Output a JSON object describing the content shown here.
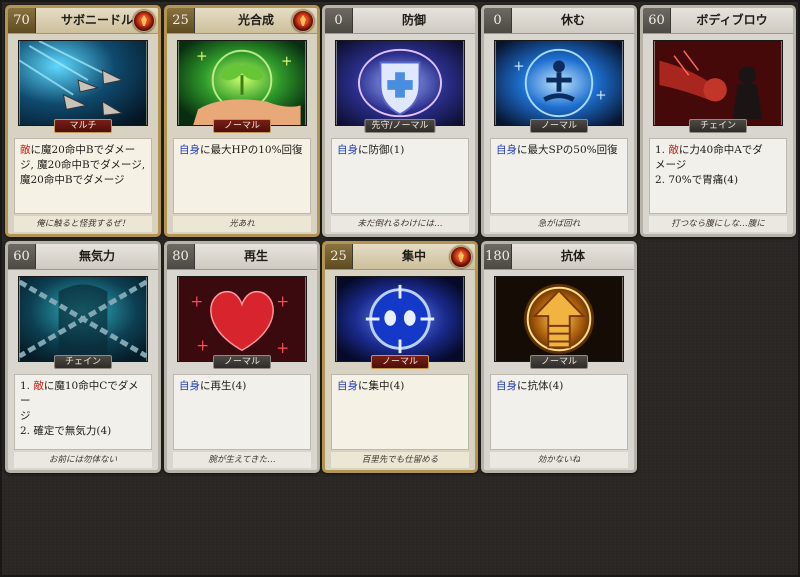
{
  "cards": [
    {
      "cost": "70",
      "title": "サボニードル",
      "rank": true,
      "type": "マルチ",
      "type_style": "red",
      "desc": [
        [
          {
            "t": "敵",
            "c": "red"
          },
          {
            "t": "に魔20命中Bでダメー"
          }
        ],
        [
          {
            "t": "ジ, 魔20命中Bでダメージ,"
          }
        ],
        [
          {
            "t": "魔20命中Bでダメージ"
          }
        ]
      ],
      "flavor": "俺に触ると怪我するぜ！",
      "art": "needle"
    },
    {
      "cost": "25",
      "title": "光合成",
      "rank": true,
      "type": "ノーマル",
      "type_style": "red",
      "desc": [
        [
          {
            "t": "自身",
            "c": "blue"
          },
          {
            "t": "に最大HPの10%回復"
          }
        ]
      ],
      "flavor": "光あれ",
      "art": "plant"
    },
    {
      "cost": "0",
      "title": "防御",
      "rank": false,
      "type": "先守/ノーマル",
      "type_style": "gray",
      "desc": [
        [
          {
            "t": "自身",
            "c": "blue"
          },
          {
            "t": "に防御(1)"
          }
        ]
      ],
      "flavor": "未だ倒れるわけには…",
      "art": "shield"
    },
    {
      "cost": "0",
      "title": "休む",
      "rank": false,
      "type": "ノーマル",
      "type_style": "gray",
      "desc": [
        [
          {
            "t": "自身",
            "c": "blue"
          },
          {
            "t": "に最大SPの50%回復"
          }
        ]
      ],
      "flavor": "急がば回れ",
      "art": "rest"
    },
    {
      "cost": "60",
      "title": "ボディブロウ",
      "rank": false,
      "type": "チェイン",
      "type_style": "gray",
      "desc": [
        [
          {
            "t": "1. "
          },
          {
            "t": "敵",
            "c": "red"
          },
          {
            "t": "に力40命中Aでダ"
          }
        ],
        [
          {
            "t": "メージ"
          }
        ],
        [
          {
            "t": "2. 70%で胃痛(4)"
          }
        ]
      ],
      "flavor": "打つなら腹にしな…腹に",
      "art": "blow"
    },
    {
      "cost": "60",
      "title": "無気力",
      "rank": false,
      "type": "チェイン",
      "type_style": "gray",
      "desc": [
        [
          {
            "t": "1. "
          },
          {
            "t": "敵",
            "c": "red"
          },
          {
            "t": "に魔10命中Cでダメー"
          }
        ],
        [
          {
            "t": "ジ"
          }
        ],
        [
          {
            "t": "2. 確定で無気力(4)"
          }
        ]
      ],
      "flavor": "お前には勿体ない",
      "art": "chains"
    },
    {
      "cost": "80",
      "title": "再生",
      "rank": false,
      "type": "ノーマル",
      "type_style": "gray",
      "desc": [
        [
          {
            "t": "自身",
            "c": "blue"
          },
          {
            "t": "に再生(4)"
          }
        ]
      ],
      "flavor": "腕が生えてきた…",
      "art": "heart"
    },
    {
      "cost": "25",
      "title": "集中",
      "rank": true,
      "type": "ノーマル",
      "type_style": "red",
      "desc": [
        [
          {
            "t": "自身",
            "c": "blue"
          },
          {
            "t": "に集中(4)"
          }
        ]
      ],
      "flavor": "百里先でも仕留める",
      "art": "focus"
    },
    {
      "cost": "180",
      "title": "抗体",
      "rank": false,
      "type": "ノーマル",
      "type_style": "gray",
      "desc": [
        [
          {
            "t": "自身",
            "c": "blue"
          },
          {
            "t": "に抗体(4)"
          }
        ]
      ],
      "flavor": "効かないね",
      "art": "arrow"
    }
  ]
}
